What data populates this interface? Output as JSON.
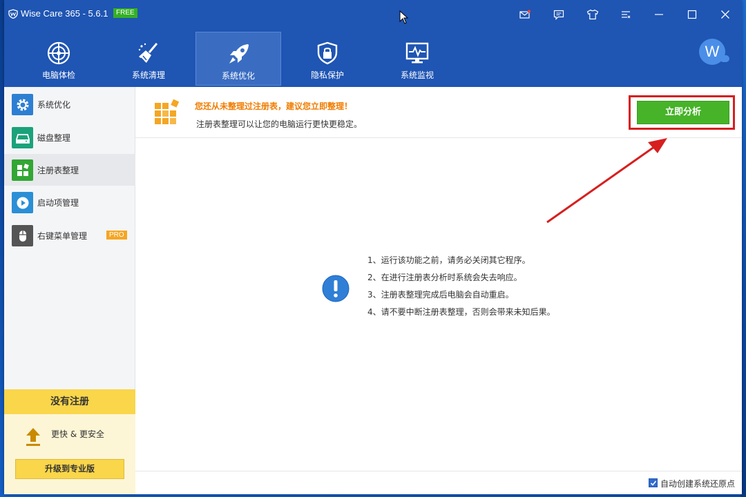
{
  "app": {
    "title": "Wise Care 365 - 5.6.1",
    "badge": "FREE"
  },
  "titlebar_icons": [
    "mail-icon",
    "chat-icon",
    "tshirt-icon",
    "menu-icon",
    "minimize-icon",
    "maximize-icon",
    "close-icon"
  ],
  "nav": {
    "items": [
      {
        "label": "电脑体检",
        "icon": "radar-icon"
      },
      {
        "label": "系统清理",
        "icon": "broom-icon"
      },
      {
        "label": "系统优化",
        "icon": "rocket-icon",
        "active": true
      },
      {
        "label": "隐私保护",
        "icon": "lock-shield-icon"
      },
      {
        "label": "系统监视",
        "icon": "monitor-pulse-icon"
      }
    ],
    "avatar_letter": "W"
  },
  "sidebar": {
    "items": [
      {
        "label": "系统优化",
        "icon": "gear-icon",
        "color": "#2d7fd3"
      },
      {
        "label": "磁盘整理",
        "icon": "disk-icon",
        "color": "#1ba27a"
      },
      {
        "label": "注册表整理",
        "icon": "blocks-icon",
        "color": "#33a634",
        "active": true
      },
      {
        "label": "启动项管理",
        "icon": "play-icon",
        "color": "#2a8fd6"
      },
      {
        "label": "右键菜单管理",
        "icon": "mouse-icon",
        "color": "#555555",
        "badge": "PRO"
      }
    ],
    "promo": {
      "header": "没有注册",
      "text": "更快 & 更安全",
      "button": "升级到专业版"
    }
  },
  "content": {
    "warning_title": "您还从未整理过注册表，建议您立即整理！",
    "warning_sub": "注册表整理可以让您的电脑运行更快更稳定。",
    "analyze_button": "立即分析",
    "tips": [
      "1、运行该功能之前，请务必关闭其它程序。",
      "2、在进行注册表分析时系统会失去响应。",
      "3、注册表整理完成后电脑会自动重启。",
      "4、请不要中断注册表整理，否则会带来未知后果。"
    ],
    "footer_checkbox": "自动创建系统还原点",
    "footer_checked": true
  },
  "colors": {
    "titlebar": "#1f55b3",
    "accent_green": "#46b328",
    "warning_orange": "#f07c00",
    "highlight_red": "#d71f1f",
    "promo_yellow": "#f9d64a"
  }
}
